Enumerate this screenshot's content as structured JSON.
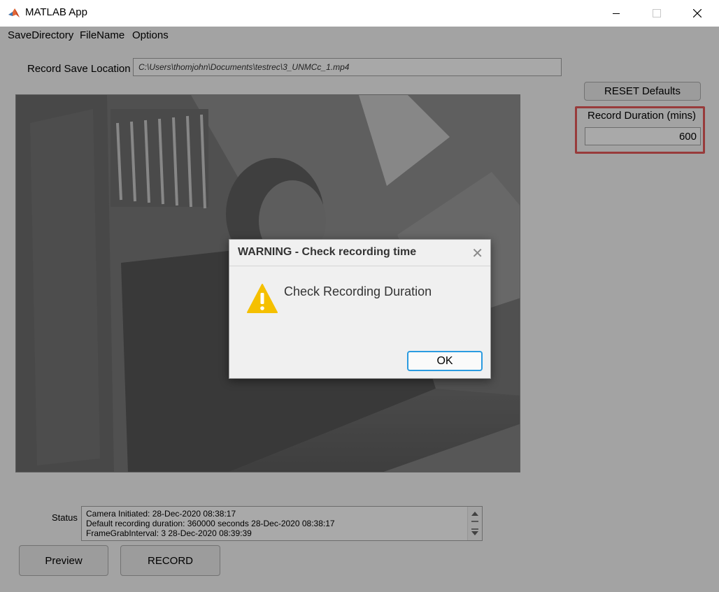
{
  "window": {
    "title": "MATLAB App",
    "controls": [
      "minimize-icon",
      "maximize-icon",
      "close-icon"
    ]
  },
  "menu": {
    "items": [
      "SaveDirectory",
      "FileName",
      "Options"
    ]
  },
  "record_save": {
    "label": "Record Save Location",
    "value": "C:\\Users\\thomjohn\\Documents\\testrec\\3_UNMCc_1.mp4"
  },
  "reset_button": "RESET Defaults",
  "duration": {
    "label": "Record Duration (mins)",
    "value": "600",
    "highlight_color": "#e05858"
  },
  "status": {
    "label": "Status",
    "lines": [
      "Camera Initiated: 28-Dec-2020 08:38:17",
      "Default recording duration: 360000 seconds 28-Dec-2020 08:38:17",
      "FrameGrabInterval: 3 28-Dec-2020 08:39:39"
    ]
  },
  "buttons": {
    "preview": "Preview",
    "record": "RECORD"
  },
  "dialog": {
    "title": "WARNING - Check recording time",
    "message": "Check Recording Duration",
    "ok": "OK",
    "icon": "warning-icon",
    "accent": "#2b9be0"
  }
}
